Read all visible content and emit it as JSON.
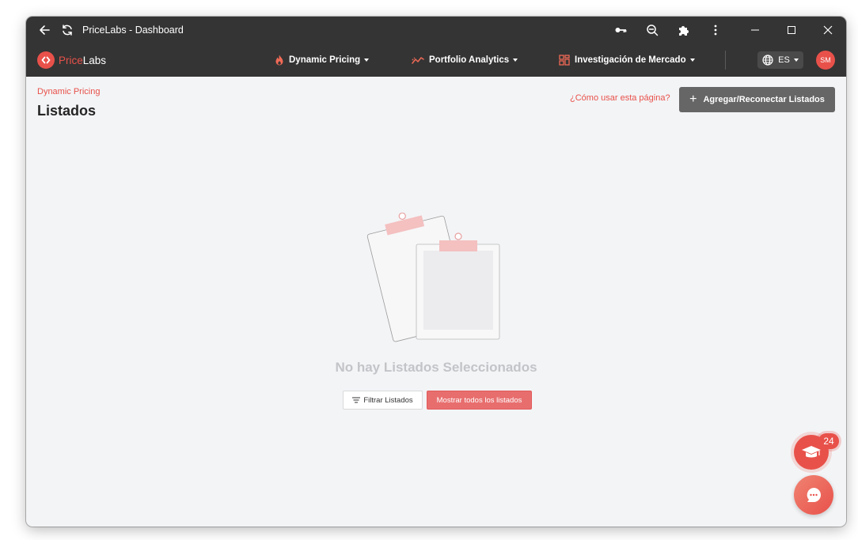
{
  "window": {
    "title": "PriceLabs - Dashboard"
  },
  "brand": {
    "price": "Price",
    "labs": "Labs",
    "accent_color": "#e8514a"
  },
  "nav": {
    "dynamic_pricing": "Dynamic Pricing",
    "portfolio_analytics": "Portfolio Analytics",
    "market_research": "Investigación de Mercado",
    "language": "ES",
    "user_initials": "SM"
  },
  "page": {
    "breadcrumb": "Dynamic Pricing",
    "title": "Listados",
    "help_link": "¿Cómo usar esta página?",
    "add_button": "Agregar/Reconectar Listados",
    "empty_message": "No hay Listados Seleccionados",
    "filter_button": "Filtrar Listados",
    "show_all_button": "Mostrar todos los listados"
  },
  "floating": {
    "edu_badge": "24"
  },
  "icons": {
    "back": "arrow-left-icon",
    "reload": "reload-icon",
    "key": "key-icon",
    "zoom": "zoom-out-icon",
    "extensions": "puzzle-icon",
    "menu": "kebab-menu-icon",
    "minimize": "minimize-icon",
    "maximize": "maximize-icon",
    "close": "close-icon",
    "flame": "flame-icon",
    "trend": "trend-icon",
    "grid": "grid-icon",
    "globe": "globe-icon",
    "filter": "filter-lines-icon",
    "graduation": "graduation-cap-icon",
    "chat": "chat-bubble-icon"
  }
}
